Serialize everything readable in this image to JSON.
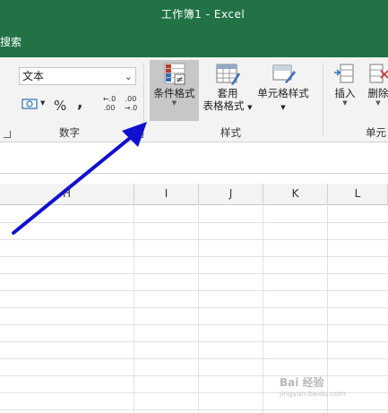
{
  "window": {
    "title": "工作簿1  -  Excel"
  },
  "tabs": {
    "search": "搜索"
  },
  "ribbon": {
    "number_group": {
      "format_value": "文本",
      "percent_symbol": "%",
      "comma_symbol": ",",
      "increase_decimal": "←.0 .00",
      "decrease_decimal": ".00 →.0",
      "label": "数字"
    },
    "styles_group": {
      "conditional_formatting": "条件格式",
      "format_as_table_line1": "套用",
      "format_as_table_line2": "表格格式",
      "cell_styles": "单元格样式",
      "label": "样式"
    },
    "cells_group": {
      "insert": "插入",
      "delete": "删除",
      "label": "单元"
    }
  },
  "grid": {
    "columns": [
      "H",
      "I",
      "J",
      "K",
      "L"
    ]
  },
  "watermark": {
    "text": "Bai  经验",
    "subtext": "jingyan.baidu.com"
  },
  "colors": {
    "excel_green": "#217346",
    "arrow_blue": "#1010d0",
    "ribbon_bg": "#f3f3f3"
  }
}
